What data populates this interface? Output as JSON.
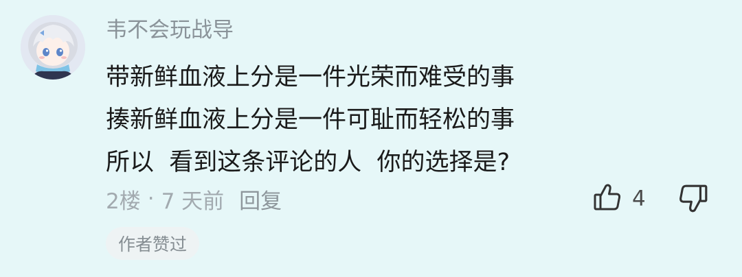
{
  "comment": {
    "username": "韦不会玩战导",
    "lines": [
      "带新鲜血液上分是一件光荣而难受的事",
      "揍新鲜血液上分是一件可耻而轻松的事",
      "所以  看到这条评论的人  你的选择是?"
    ],
    "floor": "2楼",
    "separator": "·",
    "time": "7 天前",
    "reply_label": "回复",
    "like_count": "4",
    "author_liked_badge": "作者赞过"
  },
  "icons": {
    "like": "thumbs-up-icon",
    "dislike": "thumbs-down-icon"
  },
  "colors": {
    "background": "#e6f7f8",
    "username": "#8a9399",
    "text": "#1a1a1a",
    "meta": "#a2aaaf",
    "badge_bg": "#eef3f4"
  }
}
